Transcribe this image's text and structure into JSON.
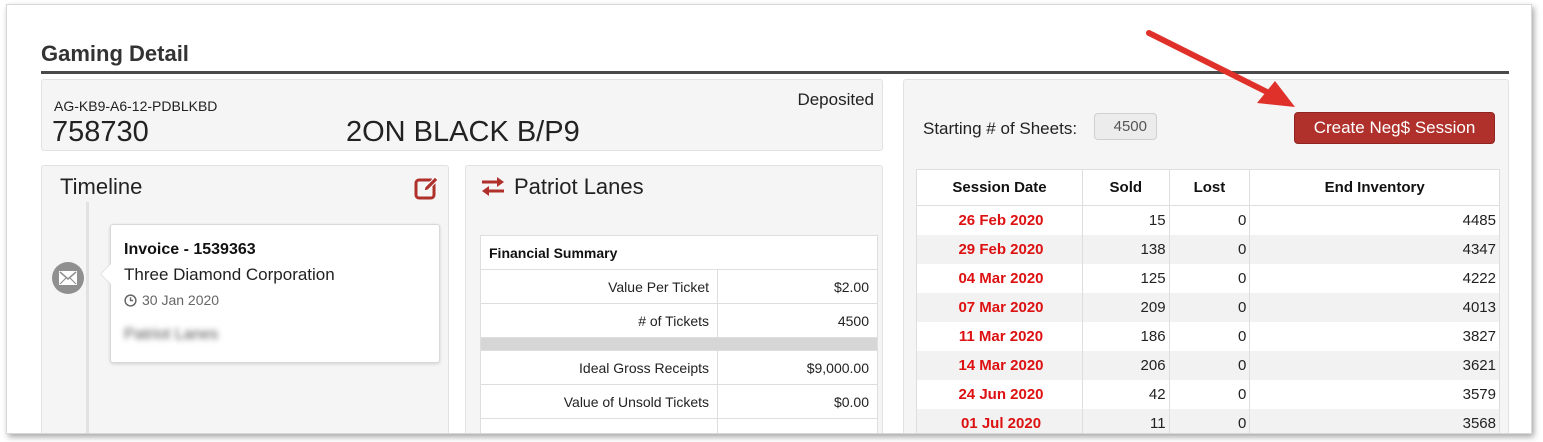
{
  "page": {
    "title": "Gaming Detail"
  },
  "header": {
    "lot_code": "AG-KB9-A6-12-PDBLKBD",
    "lot_number": "758730",
    "lot_name": "2ON BLACK B/P9",
    "status": "Deposited"
  },
  "timeline": {
    "title": "Timeline",
    "edit_icon": "edit-icon",
    "entry": {
      "icon": "envelope-icon",
      "title": "Invoice - 1539363",
      "company": "Three Diamond Corporation",
      "date_icon": "clock-icon",
      "date": "30 Jan 2020",
      "blurred_text": "Patriot Lanes"
    }
  },
  "location": {
    "icon": "swap-arrows-icon",
    "name": "Patriot Lanes",
    "financial_summary": {
      "header": "Financial Summary",
      "rows": [
        {
          "label": "Value Per Ticket",
          "value": "$2.00"
        },
        {
          "label": "# of Tickets",
          "value": "4500"
        },
        {
          "label": "Ideal Gross Receipts",
          "value": "$9,000.00"
        },
        {
          "label": "Value of Unsold Tickets",
          "value": "$0.00"
        }
      ]
    }
  },
  "sessions": {
    "starting_sheets_label": "Starting # of Sheets:",
    "starting_sheets_value": "4500",
    "create_button": "Create Neg$ Session",
    "columns": [
      "Session Date",
      "Sold",
      "Lost",
      "End Inventory"
    ],
    "rows": [
      {
        "date": "26 Feb 2020",
        "sold": "15",
        "lost": "0",
        "end": "4485"
      },
      {
        "date": "29 Feb 2020",
        "sold": "138",
        "lost": "0",
        "end": "4347"
      },
      {
        "date": "04 Mar 2020",
        "sold": "125",
        "lost": "0",
        "end": "4222"
      },
      {
        "date": "07 Mar 2020",
        "sold": "209",
        "lost": "0",
        "end": "4013"
      },
      {
        "date": "11 Mar 2020",
        "sold": "186",
        "lost": "0",
        "end": "3827"
      },
      {
        "date": "14 Mar 2020",
        "sold": "206",
        "lost": "0",
        "end": "3621"
      },
      {
        "date": "24 Jun 2020",
        "sold": "42",
        "lost": "0",
        "end": "3579"
      },
      {
        "date": "01 Jul 2020",
        "sold": "11",
        "lost": "0",
        "end": "3568"
      }
    ]
  },
  "colors": {
    "accent_red": "#b0312c",
    "date_red": "#dd1111",
    "annotation_arrow": "#e0302a"
  }
}
